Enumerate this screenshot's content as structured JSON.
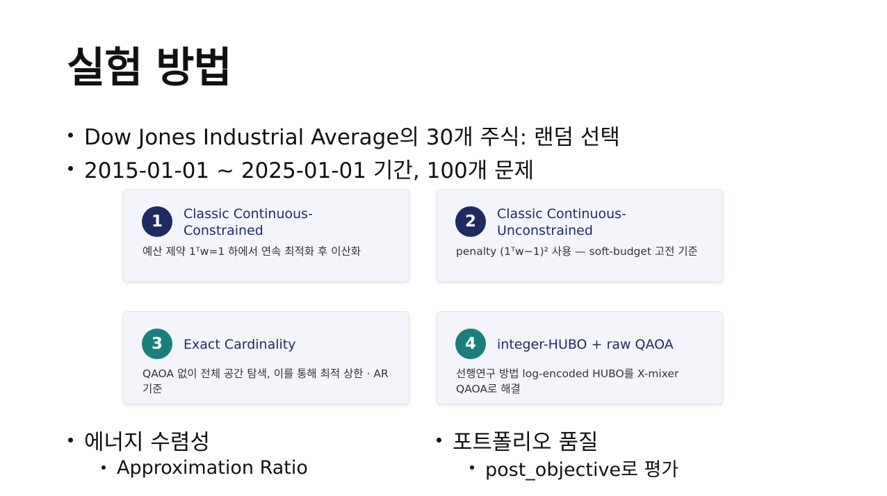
{
  "slide": {
    "title": "실험 방법",
    "bullets": [
      "Dow Jones Industrial Average의 30개 주식: 랜덤 선택",
      "2015-01-01 ~ 2025-01-01 기간, 100개 문제"
    ],
    "cards": [
      {
        "number": "1",
        "title": "Classic Continuous-Constrained",
        "desc": "예산 제약 1ᵀw=1 하에서 연속 최적화 후 이산화",
        "badge_color": "#1f2a63"
      },
      {
        "number": "2",
        "title": "Classic Continuous-Unconstrained",
        "desc": "penalty (1ᵀw−1)² 사용 — soft-budget 고전 기준",
        "badge_color": "#1f2a63"
      },
      {
        "number": "3",
        "title": "Exact Cardinality",
        "desc": "QAOA 없이 전체 공간 탐색, 이를 통해 최적 상한 · AR 기준",
        "badge_color": "#1a7f7c"
      },
      {
        "number": "4",
        "title": "integer-HUBO + raw QAOA",
        "desc": "선행연구 방법 log-encoded HUBO를 X-mixer QAOA로 해결",
        "badge_color": "#1a7f7c"
      }
    ],
    "lower_left": {
      "bullet": "에너지 수렴성",
      "sub": "Approximation Ratio"
    },
    "lower_right": {
      "bullet": "포트폴리오 품질",
      "sub": "post_objective로 평가"
    }
  }
}
